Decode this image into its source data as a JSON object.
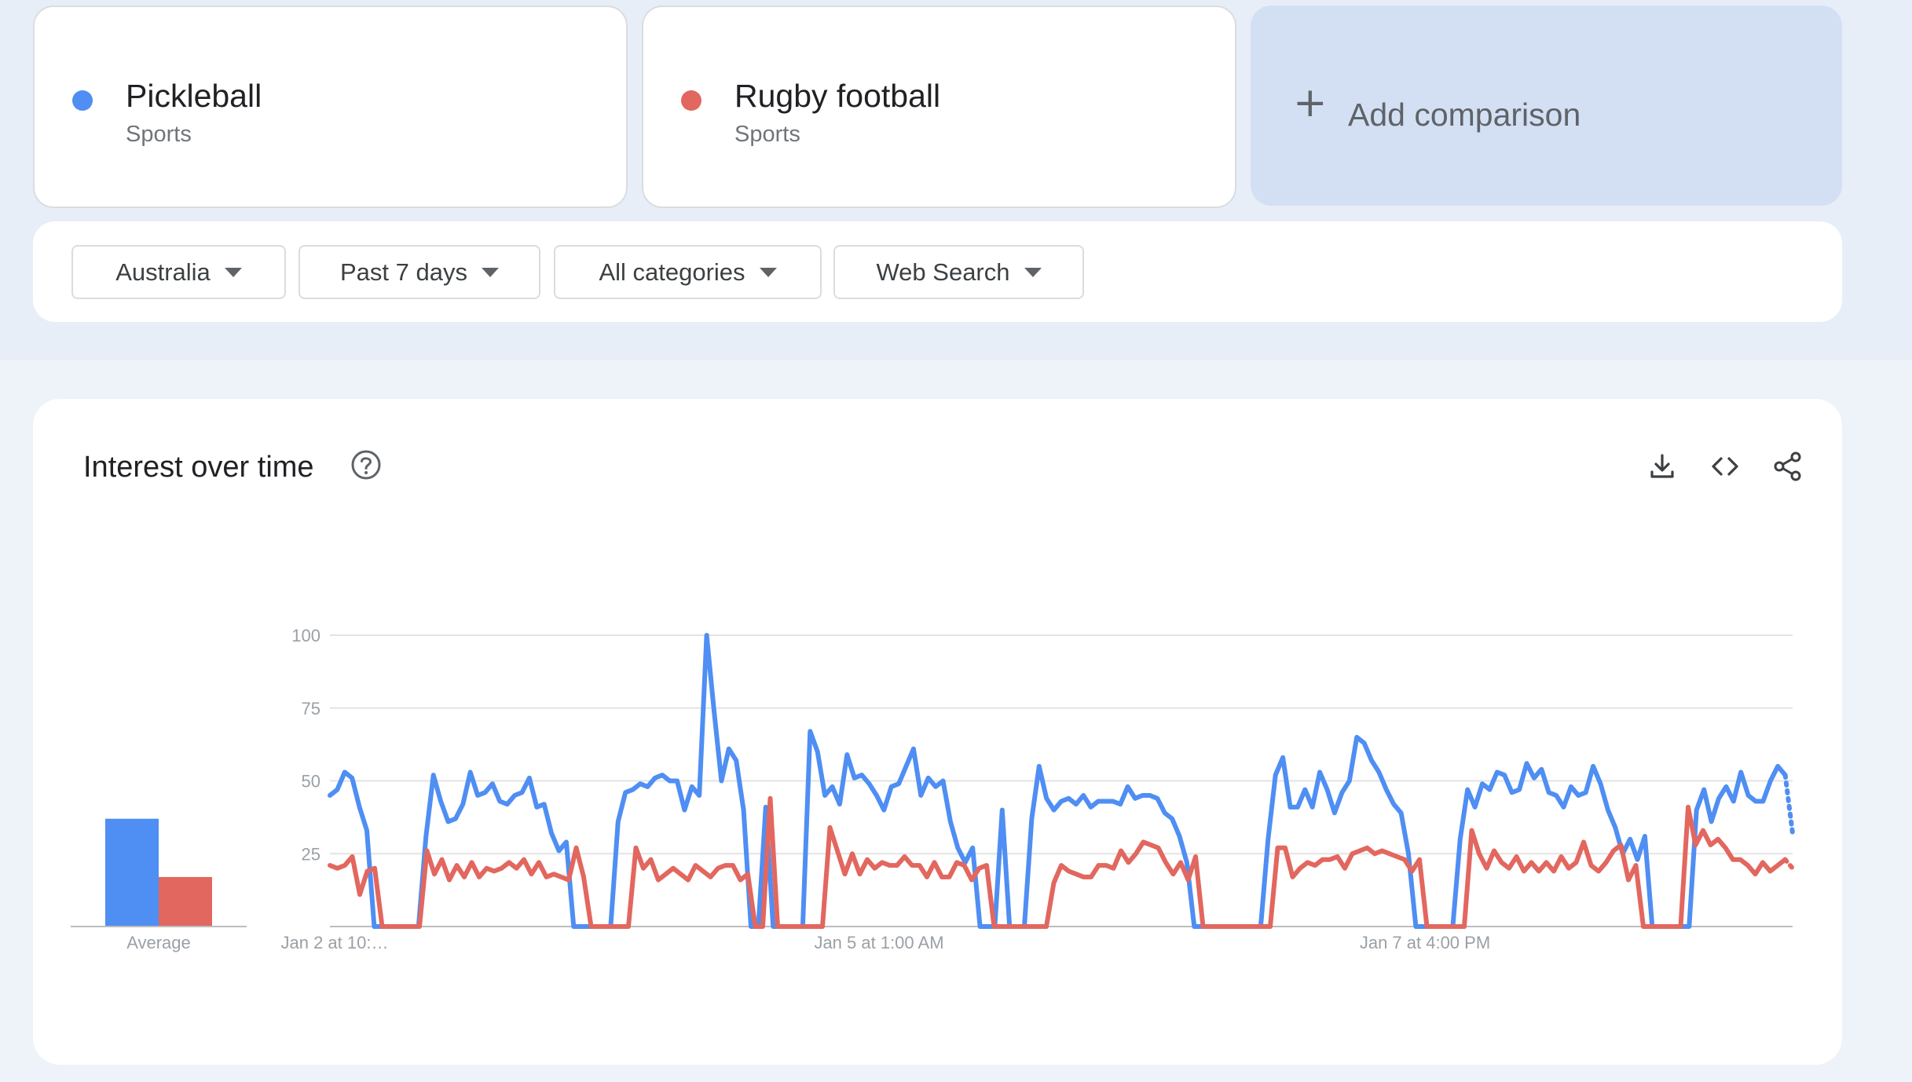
{
  "terms": [
    {
      "name": "Pickleball",
      "category": "Sports",
      "color": "#4f8ef3"
    },
    {
      "name": "Rugby football",
      "category": "Sports",
      "color": "#e2675f"
    }
  ],
  "add_comparison": {
    "label": "Add comparison",
    "icon": "plus-icon"
  },
  "filters": [
    {
      "label": "Australia"
    },
    {
      "label": "Past 7 days"
    },
    {
      "label": "All categories"
    },
    {
      "label": "Web Search"
    }
  ],
  "panel": {
    "title": "Interest over time",
    "icons": [
      "help-icon",
      "download-icon",
      "embed-code-icon",
      "share-icon"
    ]
  },
  "chart_data": {
    "type": "line",
    "ylim": [
      0,
      100
    ],
    "y_ticks": [
      "25",
      "50",
      "75",
      "100"
    ],
    "x_tick_labels": [
      "Jan 2 at 10:…",
      "Jan 5 at 1:00 AM",
      "Jan 7 at 4:00 PM"
    ],
    "average_label": "Average",
    "averages": [
      37,
      17
    ],
    "grid": true,
    "last_point_partial": true,
    "series": [
      {
        "name": "Pickleball",
        "color": "#4f8ef3",
        "values": [
          45,
          47,
          53,
          51,
          41,
          33,
          0,
          0,
          0,
          0,
          0,
          0,
          0,
          31,
          52,
          43,
          36,
          37,
          42,
          53,
          45,
          46,
          49,
          43,
          42,
          45,
          46,
          51,
          41,
          42,
          32,
          26,
          29,
          0,
          0,
          0,
          0,
          0,
          0,
          36,
          46,
          47,
          49,
          48,
          51,
          52,
          50,
          50,
          40,
          48,
          45,
          100,
          74,
          50,
          61,
          57,
          40,
          0,
          0,
          41,
          0,
          0,
          0,
          0,
          0,
          67,
          60,
          45,
          48,
          42,
          59,
          51,
          52,
          49,
          45,
          40,
          48,
          49,
          55,
          61,
          45,
          51,
          48,
          50,
          36,
          27,
          22,
          27,
          0,
          0,
          0,
          40,
          0,
          0,
          0,
          37,
          55,
          44,
          40,
          43,
          44,
          42,
          45,
          41,
          43,
          43,
          43,
          42,
          48,
          44,
          45,
          45,
          44,
          39,
          37,
          31,
          22,
          0,
          0,
          0,
          0,
          0,
          0,
          0,
          0,
          0,
          0,
          30,
          52,
          58,
          41,
          41,
          47,
          41,
          53,
          47,
          39,
          46,
          50,
          65,
          63,
          57,
          53,
          47,
          42,
          39,
          25,
          0,
          0,
          0,
          0,
          0,
          0,
          30,
          47,
          41,
          49,
          47,
          53,
          52,
          46,
          47,
          56,
          51,
          54,
          46,
          45,
          41,
          48,
          45,
          46,
          55,
          49,
          40,
          34,
          25,
          30,
          23,
          31,
          0,
          0,
          0,
          0,
          0,
          0,
          40,
          47,
          36,
          44,
          48,
          43,
          53,
          45,
          43,
          43,
          50,
          55,
          52,
          32
        ]
      },
      {
        "name": "Rugby football",
        "color": "#e2675f",
        "values": [
          21,
          20,
          21,
          24,
          11,
          19,
          20,
          0,
          0,
          0,
          0,
          0,
          0,
          26,
          18,
          23,
          16,
          21,
          17,
          22,
          17,
          20,
          19,
          20,
          22,
          20,
          23,
          18,
          22,
          17,
          18,
          17,
          16,
          27,
          17,
          0,
          0,
          0,
          0,
          0,
          0,
          27,
          20,
          23,
          16,
          18,
          20,
          18,
          16,
          21,
          19,
          17,
          20,
          21,
          21,
          16,
          18,
          0,
          0,
          44,
          0,
          0,
          0,
          0,
          0,
          0,
          0,
          34,
          26,
          18,
          25,
          18,
          23,
          20,
          22,
          21,
          21,
          24,
          21,
          21,
          17,
          22,
          17,
          17,
          22,
          21,
          16,
          20,
          21,
          0,
          0,
          0,
          0,
          0,
          0,
          0,
          0,
          15,
          21,
          19,
          18,
          17,
          17,
          21,
          21,
          20,
          26,
          22,
          25,
          29,
          28,
          27,
          22,
          18,
          22,
          16,
          24,
          0,
          0,
          0,
          0,
          0,
          0,
          0,
          0,
          0,
          0,
          27,
          27,
          17,
          20,
          22,
          21,
          23,
          23,
          24,
          20,
          25,
          26,
          27,
          25,
          26,
          25,
          24,
          23,
          19,
          23,
          0,
          0,
          0,
          0,
          0,
          0,
          33,
          25,
          20,
          26,
          22,
          20,
          24,
          19,
          22,
          19,
          22,
          19,
          24,
          20,
          22,
          29,
          21,
          19,
          22,
          26,
          28,
          16,
          21,
          0,
          0,
          0,
          0,
          0,
          0,
          41,
          28,
          33,
          28,
          30,
          27,
          23,
          23,
          21,
          18,
          22,
          19,
          21,
          23,
          20
        ]
      }
    ]
  }
}
